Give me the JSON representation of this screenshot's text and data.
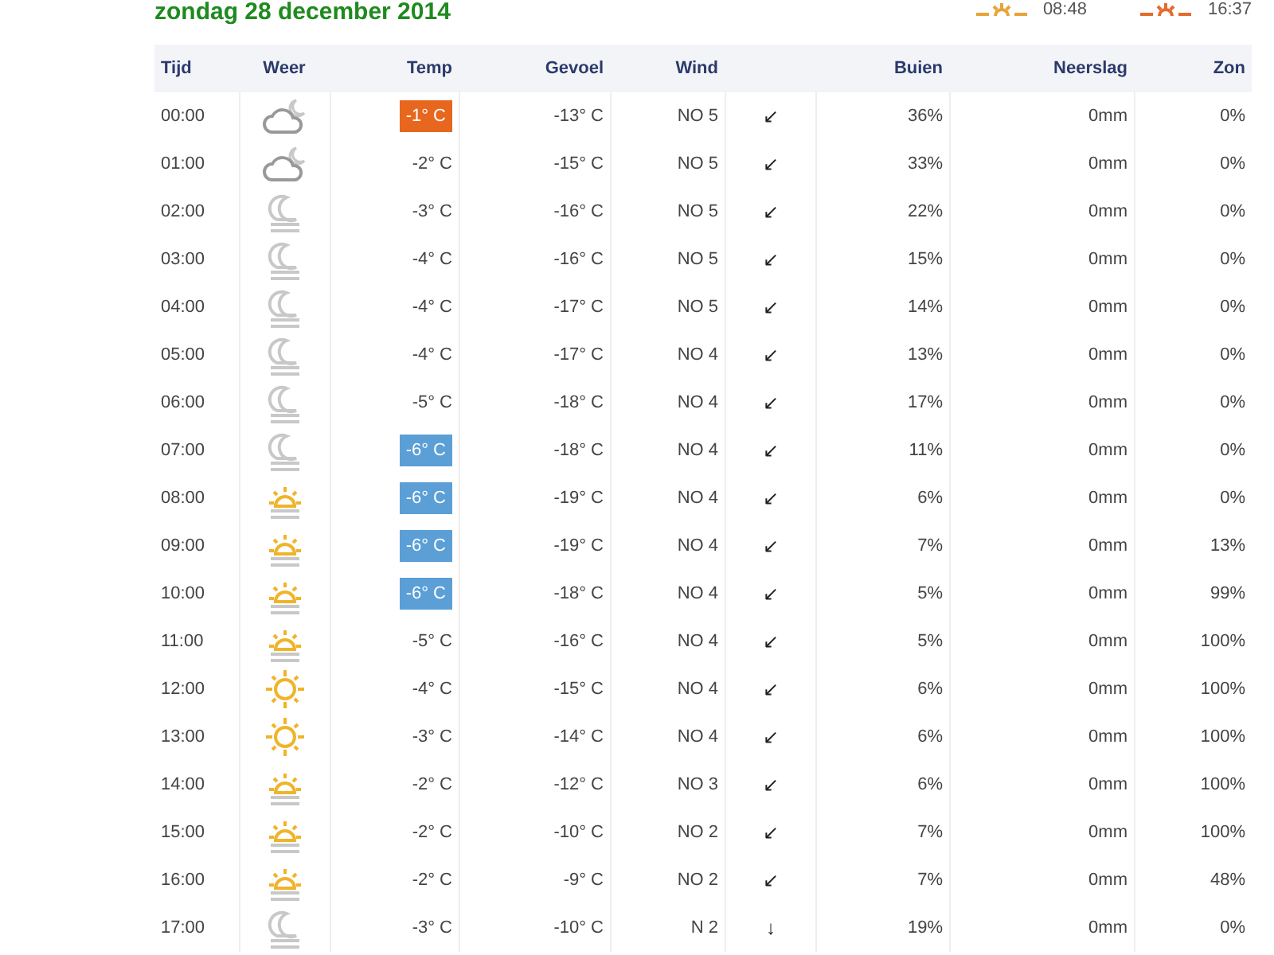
{
  "header": {
    "date": "zondag 28 december 2014",
    "sunrise": "08:48",
    "sunset": "16:37"
  },
  "table": {
    "columns": [
      "Tijd",
      "Weer",
      "Temp",
      "Gevoel",
      "Wind",
      "Buien",
      "Neerslag",
      "Zon"
    ],
    "rows": [
      {
        "time": "00:00",
        "kind": "cloudy",
        "temp": "-1° C",
        "color": "#e8671e",
        "feel": "-13° C",
        "wind": "NO 5",
        "arrow": "↙",
        "showers": "36%",
        "precip": "0mm",
        "sun": "0%"
      },
      {
        "time": "01:00",
        "kind": "cloudy",
        "temp": "-2° C",
        "feel": "-15° C",
        "wind": "NO 5",
        "arrow": "↙",
        "showers": "33%",
        "precip": "0mm",
        "sun": "0%"
      },
      {
        "time": "02:00",
        "kind": "mist",
        "temp": "-3° C",
        "feel": "-16° C",
        "wind": "NO 5",
        "arrow": "↙",
        "showers": "22%",
        "precip": "0mm",
        "sun": "0%"
      },
      {
        "time": "03:00",
        "kind": "mist",
        "temp": "-4° C",
        "feel": "-16° C",
        "wind": "NO 5",
        "arrow": "↙",
        "showers": "15%",
        "precip": "0mm",
        "sun": "0%"
      },
      {
        "time": "04:00",
        "kind": "mist",
        "temp": "-4° C",
        "feel": "-17° C",
        "wind": "NO 5",
        "arrow": "↙",
        "showers": "14%",
        "precip": "0mm",
        "sun": "0%"
      },
      {
        "time": "05:00",
        "kind": "mist",
        "temp": "-4° C",
        "feel": "-17° C",
        "wind": "NO 4",
        "arrow": "↙",
        "showers": "13%",
        "precip": "0mm",
        "sun": "0%"
      },
      {
        "time": "06:00",
        "kind": "mist",
        "temp": "-5° C",
        "feel": "-18° C",
        "wind": "NO 4",
        "arrow": "↙",
        "showers": "17%",
        "precip": "0mm",
        "sun": "0%"
      },
      {
        "time": "07:00",
        "kind": "mist",
        "temp": "-6° C",
        "color": "#5b9fd6",
        "feel": "-18° C",
        "wind": "NO 4",
        "arrow": "↙",
        "showers": "11%",
        "precip": "0mm",
        "sun": "0%"
      },
      {
        "time": "08:00",
        "kind": "hazy",
        "temp": "-6° C",
        "color": "#5b9fd6",
        "feel": "-19° C",
        "wind": "NO 4",
        "arrow": "↙",
        "showers": "6%",
        "precip": "0mm",
        "sun": "0%"
      },
      {
        "time": "09:00",
        "kind": "hazy",
        "temp": "-6° C",
        "color": "#5b9fd6",
        "feel": "-19° C",
        "wind": "NO 4",
        "arrow": "↙",
        "showers": "7%",
        "precip": "0mm",
        "sun": "13%"
      },
      {
        "time": "10:00",
        "kind": "hazy",
        "temp": "-6° C",
        "color": "#5b9fd6",
        "feel": "-18° C",
        "wind": "NO 4",
        "arrow": "↙",
        "showers": "5%",
        "precip": "0mm",
        "sun": "99%"
      },
      {
        "time": "11:00",
        "kind": "hazy",
        "temp": "-5° C",
        "feel": "-16° C",
        "wind": "NO 4",
        "arrow": "↙",
        "showers": "5%",
        "precip": "0mm",
        "sun": "100%"
      },
      {
        "time": "12:00",
        "kind": "sunny",
        "temp": "-4° C",
        "feel": "-15° C",
        "wind": "NO 4",
        "arrow": "↙",
        "showers": "6%",
        "precip": "0mm",
        "sun": "100%"
      },
      {
        "time": "13:00",
        "kind": "sunny",
        "temp": "-3° C",
        "feel": "-14° C",
        "wind": "NO 4",
        "arrow": "↙",
        "showers": "6%",
        "precip": "0mm",
        "sun": "100%"
      },
      {
        "time": "14:00",
        "kind": "hazy",
        "temp": "-2° C",
        "feel": "-12° C",
        "wind": "NO 3",
        "arrow": "↙",
        "showers": "6%",
        "precip": "0mm",
        "sun": "100%"
      },
      {
        "time": "15:00",
        "kind": "hazy",
        "temp": "-2° C",
        "feel": "-10° C",
        "wind": "NO 2",
        "arrow": "↙",
        "showers": "7%",
        "precip": "0mm",
        "sun": "100%"
      },
      {
        "time": "16:00",
        "kind": "hazy",
        "temp": "-2° C",
        "feel": "-9° C",
        "wind": "NO 2",
        "arrow": "↙",
        "showers": "7%",
        "precip": "0mm",
        "sun": "48%"
      },
      {
        "time": "17:00",
        "kind": "mist",
        "temp": "-3° C",
        "feel": "-10° C",
        "wind": "N 2",
        "arrow": "↓",
        "showers": "19%",
        "precip": "0mm",
        "sun": "0%"
      }
    ]
  }
}
